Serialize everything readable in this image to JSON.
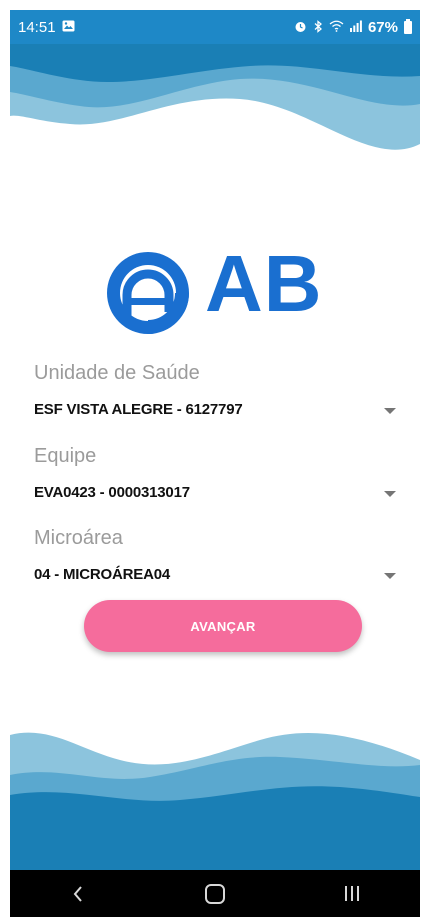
{
  "status_bar": {
    "time": "14:51",
    "battery": "67%",
    "icons": [
      "gallery-icon",
      "alarm-icon",
      "bluetooth-icon",
      "wifi-icon",
      "signal-icon",
      "battery-icon"
    ]
  },
  "logo": {
    "text": "AB"
  },
  "form": {
    "unidade": {
      "label": "Unidade de Saúde",
      "value": "ESF VISTA ALEGRE - 6127797"
    },
    "equipe": {
      "label": "Equipe",
      "value": "EVA0423 - 0000313017"
    },
    "microarea": {
      "label": "Microárea",
      "value": "04 - MICROÁREA04"
    },
    "submit_label": "AVANÇAR"
  },
  "colors": {
    "primary": "#1e88c7",
    "logo_blue": "#1a6fd0",
    "button_pink": "#f56c9c",
    "wave_light": "#8cc4dd",
    "wave_dark": "#1a7fb5"
  },
  "nav_bar": {
    "icons": [
      "back-icon",
      "home-icon",
      "recents-icon"
    ]
  }
}
